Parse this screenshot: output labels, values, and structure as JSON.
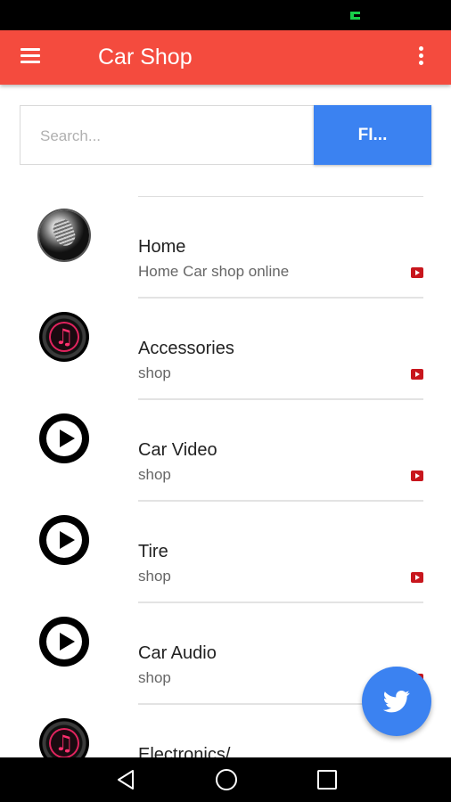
{
  "app_bar": {
    "title": "Car Shop",
    "menu_icon": "hamburger-menu-icon",
    "more_icon": "more-vert-icon",
    "color": "#f44b3e"
  },
  "search": {
    "placeholder": "Search...",
    "value": "",
    "button_label": "FI..."
  },
  "items": [
    {
      "title": "Home",
      "subtitle": "Home Car shop online",
      "icon": "microphone-icon"
    },
    {
      "title": "Accessories",
      "subtitle": "shop",
      "icon": "music-note-icon"
    },
    {
      "title": "Car Video",
      "subtitle": "shop",
      "icon": "play-icon"
    },
    {
      "title": "Tire",
      "subtitle": "shop",
      "icon": "play-icon"
    },
    {
      "title": "Car Audio",
      "subtitle": "shop",
      "icon": "play-icon"
    },
    {
      "title": "Electronics/",
      "subtitle": "",
      "icon": "music-note-icon"
    }
  ],
  "fab": {
    "icon": "twitter-bird-icon",
    "color": "#3b82f1"
  },
  "nav": {
    "back_icon": "back-icon",
    "home_icon": "home-icon",
    "recent_icon": "recent-apps-icon"
  }
}
